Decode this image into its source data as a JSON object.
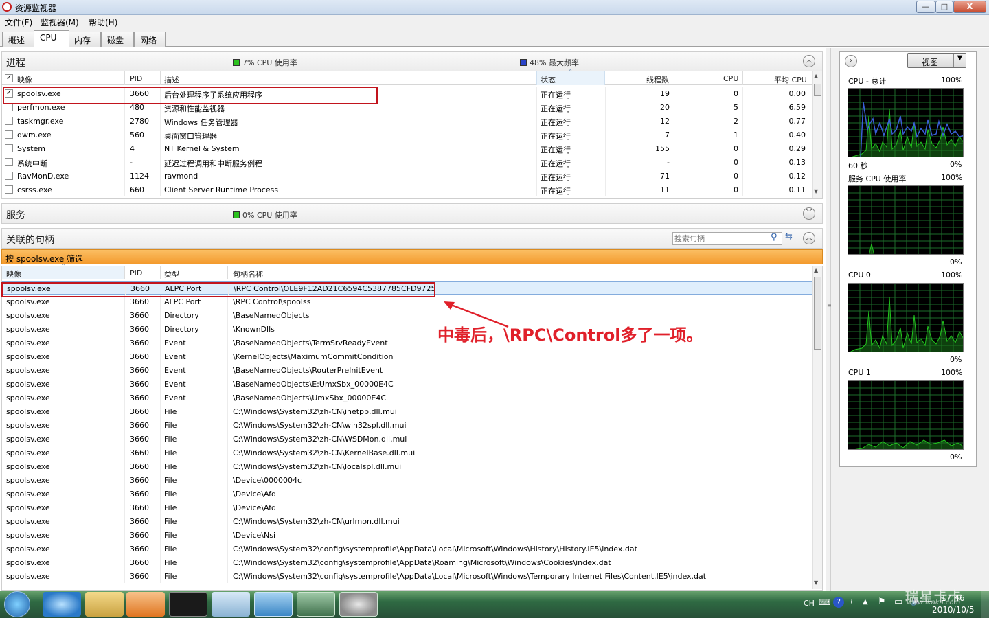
{
  "window": {
    "title": "资源监视器",
    "min": "—",
    "max": "□",
    "close": "X"
  },
  "menu": [
    "文件(F)",
    "监视器(M)",
    "帮助(H)"
  ],
  "tabs": [
    "概述",
    "CPU",
    "内存",
    "磁盘",
    "网络"
  ],
  "process_section": {
    "title": "进程",
    "cpu_usage": "7% CPU 使用率",
    "max_freq": "48% 最大频率",
    "columns": [
      "映像",
      "PID",
      "描述",
      "状态",
      "线程数",
      "CPU",
      "平均 CPU"
    ],
    "rows": [
      {
        "image": "spoolsv.exe",
        "pid": "3660",
        "desc": "后台处理程序子系统应用程序",
        "status": "正在运行",
        "threads": "19",
        "cpu": "0",
        "avg": "0.00",
        "checked": true
      },
      {
        "image": "perfmon.exe",
        "pid": "480",
        "desc": "资源和性能监视器",
        "status": "正在运行",
        "threads": "20",
        "cpu": "5",
        "avg": "6.59",
        "checked": false
      },
      {
        "image": "taskmgr.exe",
        "pid": "2780",
        "desc": "Windows 任务管理器",
        "status": "正在运行",
        "threads": "12",
        "cpu": "2",
        "avg": "0.77",
        "checked": false
      },
      {
        "image": "dwm.exe",
        "pid": "560",
        "desc": "桌面窗口管理器",
        "status": "正在运行",
        "threads": "7",
        "cpu": "1",
        "avg": "0.40",
        "checked": false
      },
      {
        "image": "System",
        "pid": "4",
        "desc": "NT Kernel & System",
        "status": "正在运行",
        "threads": "155",
        "cpu": "0",
        "avg": "0.29",
        "checked": false
      },
      {
        "image": "系统中断",
        "pid": "-",
        "desc": "延迟过程调用和中断服务例程",
        "status": "正在运行",
        "threads": "-",
        "cpu": "0",
        "avg": "0.13",
        "checked": false
      },
      {
        "image": "RavMonD.exe",
        "pid": "1124",
        "desc": "ravmond",
        "status": "正在运行",
        "threads": "71",
        "cpu": "0",
        "avg": "0.12",
        "checked": false
      },
      {
        "image": "csrss.exe",
        "pid": "660",
        "desc": "Client Server Runtime Process",
        "status": "正在运行",
        "threads": "11",
        "cpu": "0",
        "avg": "0.11",
        "checked": false
      }
    ]
  },
  "services_section": {
    "title": "服务",
    "cpu_usage": "0% CPU 使用率"
  },
  "handles_section": {
    "title": "关联的句柄",
    "search_placeholder": "搜索句柄",
    "filter_bar": "按 spoolsv.exe 筛选",
    "columns": [
      "映像",
      "PID",
      "类型",
      "句柄名称"
    ],
    "rows": [
      [
        "spoolsv.exe",
        "3660",
        "ALPC Port",
        "\\RPC Control\\OLE9F12AD21C6594C5387785CFD9725"
      ],
      [
        "spoolsv.exe",
        "3660",
        "ALPC Port",
        "\\RPC Control\\spoolss"
      ],
      [
        "spoolsv.exe",
        "3660",
        "Directory",
        "\\BaseNamedObjects"
      ],
      [
        "spoolsv.exe",
        "3660",
        "Directory",
        "\\KnownDlls"
      ],
      [
        "spoolsv.exe",
        "3660",
        "Event",
        "\\BaseNamedObjects\\TermSrvReadyEvent"
      ],
      [
        "spoolsv.exe",
        "3660",
        "Event",
        "\\KernelObjects\\MaximumCommitCondition"
      ],
      [
        "spoolsv.exe",
        "3660",
        "Event",
        "\\BaseNamedObjects\\RouterPreInitEvent"
      ],
      [
        "spoolsv.exe",
        "3660",
        "Event",
        "\\BaseNamedObjects\\E:UmxSbx_00000E4C"
      ],
      [
        "spoolsv.exe",
        "3660",
        "Event",
        "\\BaseNamedObjects\\UmxSbx_00000E4C"
      ],
      [
        "spoolsv.exe",
        "3660",
        "File",
        "C:\\Windows\\System32\\zh-CN\\inetpp.dll.mui"
      ],
      [
        "spoolsv.exe",
        "3660",
        "File",
        "C:\\Windows\\System32\\zh-CN\\win32spl.dll.mui"
      ],
      [
        "spoolsv.exe",
        "3660",
        "File",
        "C:\\Windows\\System32\\zh-CN\\WSDMon.dll.mui"
      ],
      [
        "spoolsv.exe",
        "3660",
        "File",
        "C:\\Windows\\System32\\zh-CN\\KernelBase.dll.mui"
      ],
      [
        "spoolsv.exe",
        "3660",
        "File",
        "C:\\Windows\\System32\\zh-CN\\localspl.dll.mui"
      ],
      [
        "spoolsv.exe",
        "3660",
        "File",
        "\\Device\\0000004c"
      ],
      [
        "spoolsv.exe",
        "3660",
        "File",
        "\\Device\\Afd"
      ],
      [
        "spoolsv.exe",
        "3660",
        "File",
        "\\Device\\Afd"
      ],
      [
        "spoolsv.exe",
        "3660",
        "File",
        "C:\\Windows\\System32\\zh-CN\\urlmon.dll.mui"
      ],
      [
        "spoolsv.exe",
        "3660",
        "File",
        "\\Device\\Nsi"
      ],
      [
        "spoolsv.exe",
        "3660",
        "File",
        "C:\\Windows\\System32\\config\\systemprofile\\AppData\\Local\\Microsoft\\Windows\\History\\History.IE5\\index.dat"
      ],
      [
        "spoolsv.exe",
        "3660",
        "File",
        "C:\\Windows\\System32\\config\\systemprofile\\AppData\\Roaming\\Microsoft\\Windows\\Cookies\\index.dat"
      ],
      [
        "spoolsv.exe",
        "3660",
        "File",
        "C:\\Windows\\System32\\config\\systemprofile\\AppData\\Local\\Microsoft\\Windows\\Temporary Internet Files\\Content.IE5\\index.dat"
      ]
    ]
  },
  "annotation": "中毒后，\\RPC\\Control多了一项。",
  "right_panel": {
    "view_label": "视图",
    "graphs": [
      {
        "title": "CPU - 总计",
        "max": "100%",
        "time": "60 秒",
        "min": "0%"
      },
      {
        "title": "服务 CPU 使用率",
        "max": "100%",
        "min": "0%"
      },
      {
        "title": "CPU 0",
        "max": "100%",
        "min": "0%"
      },
      {
        "title": "CPU 1",
        "max": "100%",
        "min": "0%"
      }
    ]
  },
  "taskbar": {
    "lang": "CH",
    "time": "17:46",
    "date": "2010/10/5",
    "watermark": "瑞星卡卡",
    "watermark_url": "www.ikaka.com"
  },
  "colors": {
    "filter_bar": "#f7a843",
    "annotation": "#e0202a",
    "redbox": "#c2141d",
    "graph_green": "#22c51e",
    "graph_blue": "#3a5fd8",
    "graph_grid": "#1d6b2a"
  }
}
